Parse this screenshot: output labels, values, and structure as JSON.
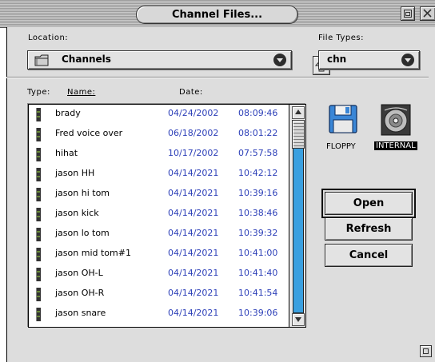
{
  "window": {
    "title": "Channel Files..."
  },
  "location": {
    "label": "Location:",
    "value": "Channels"
  },
  "file_types": {
    "label": "File Types:",
    "value": "chn"
  },
  "list_header": {
    "type": "Type:",
    "name": "Name:",
    "date": "Date:"
  },
  "files": [
    {
      "name": "brady",
      "date": "04/24/2002",
      "time": "08:09:46"
    },
    {
      "name": "Fred voice over",
      "date": "06/18/2002",
      "time": "08:01:22"
    },
    {
      "name": "hihat",
      "date": "10/17/2002",
      "time": "07:57:58"
    },
    {
      "name": "jason HH",
      "date": "04/14/2021",
      "time": "10:42:12"
    },
    {
      "name": "jason hi tom",
      "date": "04/14/2021",
      "time": "10:39:16"
    },
    {
      "name": "jason kick",
      "date": "04/14/2021",
      "time": "10:38:46"
    },
    {
      "name": "jason lo tom",
      "date": "04/14/2021",
      "time": "10:39:32"
    },
    {
      "name": "jason mid tom#1",
      "date": "04/14/2021",
      "time": "10:41:00"
    },
    {
      "name": "jason OH-L",
      "date": "04/14/2021",
      "time": "10:41:40"
    },
    {
      "name": "jason OH-R",
      "date": "04/14/2021",
      "time": "10:41:54"
    },
    {
      "name": "jason snare",
      "date": "04/14/2021",
      "time": "10:39:06"
    }
  ],
  "devices": {
    "floppy": "FLOPPY",
    "internal": "INTERNAL"
  },
  "buttons": {
    "open": "Open",
    "refresh": "Refresh",
    "cancel": "Cancel"
  },
  "colors": {
    "date_text": "#2c3fb8",
    "scroll_track": "#3aa0e0",
    "dialog_bg": "#dddddd"
  }
}
